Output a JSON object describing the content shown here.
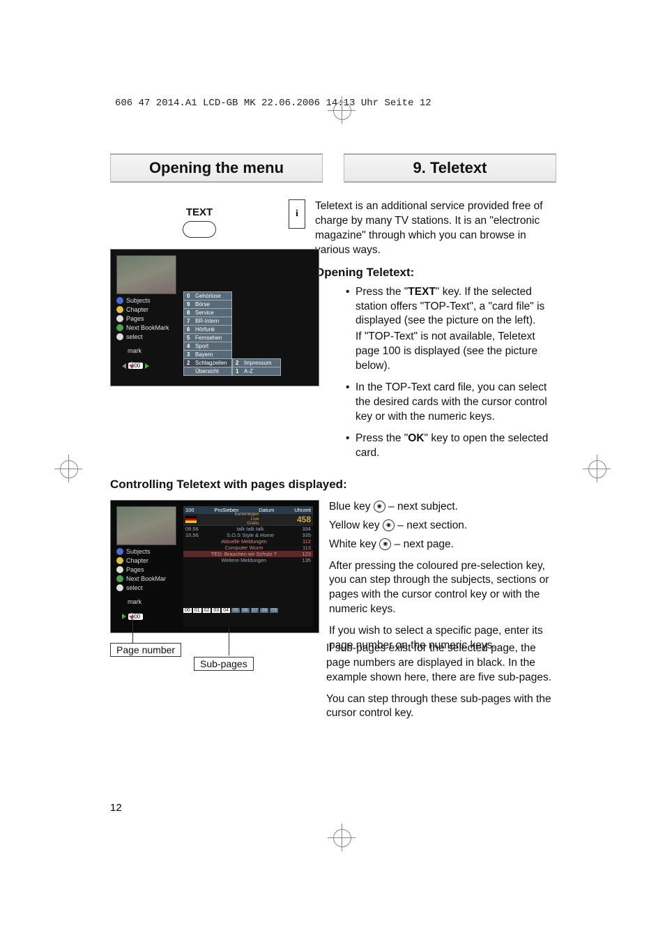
{
  "print_header": "606 47 2014.A1 LCD-GB MK  22.06.2006  14:13 Uhr  Seite 12",
  "titles": {
    "left": "Opening the menu",
    "right": "9. Teletext"
  },
  "left_panel": {
    "info_icon": "i",
    "text_label": "TEXT"
  },
  "screenshot1": {
    "menu": [
      "Subjects",
      "Chapter",
      "Pages",
      "Next BookMark",
      "select"
    ],
    "mark_label": "mark",
    "nav_page": "100",
    "cards_main": [
      {
        "n": "0",
        "label": "Gehörlose"
      },
      {
        "n": "9",
        "label": "Börse"
      },
      {
        "n": "8",
        "label": "Service"
      },
      {
        "n": "7",
        "label": "BR-Intern"
      },
      {
        "n": "6",
        "label": "Hörfunk"
      },
      {
        "n": "5",
        "label": "Fernsehen"
      },
      {
        "n": "4",
        "label": "Sport"
      },
      {
        "n": "3",
        "label": "Bayern"
      },
      {
        "n": "2",
        "label": "Schlagzeilen"
      },
      {
        "n": "",
        "label": "Übersicht"
      }
    ],
    "cards_side": [
      {
        "n": "2",
        "label": "Impressum"
      },
      {
        "n": "1",
        "label": "A-Z"
      }
    ]
  },
  "intro": "Teletext is an additional service provided free of charge by many TV stations. It is an \"electronic magazine\" through which you can browse in various ways.",
  "opening": {
    "heading": "Opening Teletext:",
    "bullets": [
      {
        "pre": "Press the \"",
        "bold": "TEXT",
        "post": "\" key. If the selected station offers \"TOP-Text\", a \"card file\" is displayed (see the picture on the left).",
        "extra": "If \"TOP-Text\" is not available, Teletext page 100 is displayed (see the picture below)."
      },
      {
        "pre": "In the TOP-Text card file, you can select the desired cards with the cursor control key or with the numeric keys."
      },
      {
        "pre": "Press the \"",
        "bold": "OK",
        "post": "\" key to open the selected card."
      }
    ]
  },
  "controlling": {
    "heading": "Controlling Teletext with pages displayed:",
    "lines": [
      {
        "pre": "Blue key ",
        "icon": "◉",
        "post": " – next subject."
      },
      {
        "pre": "Yellow key ",
        "icon": "◉",
        "post": " – next section."
      },
      {
        "pre": "White key ",
        "icon": "◉",
        "post": " – next page."
      }
    ],
    "para1": "After pressing the coloured pre-selection key, you can step through the subjects, sections or pages with the cursor control key or with the numeric keys.",
    "para2": "If you wish to select a specific page, enter its page number on the numeric keys."
  },
  "subpara1": "If sub-pages exist for the selected page, the page numbers are displayed in black. In the example shown here, there are five sub-pages.",
  "subpara2": "You can step through these sub-pages with the cursor control key.",
  "screenshot2": {
    "menu": [
      "Subjects",
      "Chapter",
      "Pages",
      "Next BookMar",
      "select"
    ],
    "mark_label": "mark",
    "nav_page": "100",
    "ttx_header_left": "100",
    "ttx_header_mid": "ProSieben",
    "ttx_header_right1": "Datum",
    "ttx_header_right2": "Uhrzeit",
    "promo_lines": [
      "Kartenlegen",
      "Live",
      "Gratis"
    ],
    "promo_num": "458",
    "rows": [
      {
        "l": "09.56",
        "m": "talk talk talk",
        "r": "334"
      },
      {
        "l": "10.56",
        "m": "S.O.S Style & Home",
        "r": "335"
      },
      {
        "l": "",
        "m": "Aktuelle Meldungen",
        "r": "112"
      },
      {
        "l": "",
        "m": "Computer Wurm",
        "r": "113"
      },
      {
        "l": "",
        "m": "TED: Brauchen wir Schutz ?",
        "r": "123",
        "red": true
      },
      {
        "l": "",
        "m": "Weitere Meldungen",
        "r": "135"
      }
    ],
    "subpages_active": [
      "00",
      "01",
      "02",
      "03",
      "04"
    ],
    "subpages_dim": [
      "05",
      "06",
      "07",
      "08",
      "09"
    ]
  },
  "callouts": {
    "page_number": "Page number",
    "sub_pages": "Sub-pages"
  },
  "page_number": "12"
}
